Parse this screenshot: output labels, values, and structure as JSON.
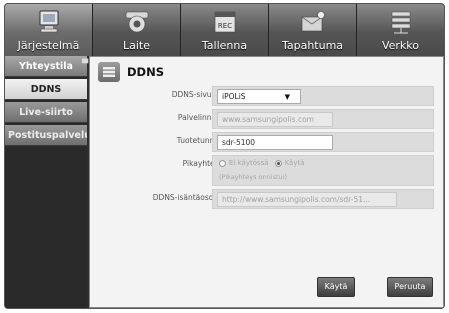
{
  "tabs": [
    {
      "label": "Järjestelmä",
      "icon": "system-icon"
    },
    {
      "label": "Laite",
      "icon": "camera-icon"
    },
    {
      "label": "Tallenna",
      "icon": "record-icon"
    },
    {
      "label": "Tapahtuma",
      "icon": "event-icon"
    },
    {
      "label": "Verkko",
      "icon": "network-icon"
    }
  ],
  "sidebar": {
    "items": [
      {
        "label": "Yhteystila"
      },
      {
        "label": "DDNS"
      },
      {
        "label": "Live-siirto"
      },
      {
        "label": "Postituspalvelu"
      }
    ]
  },
  "content": {
    "title": "DDNS",
    "service_label": "DDNS-sivusto",
    "service_value": "iPOLiS",
    "host_label": "Palvelinnimi",
    "host_value": "www.samsungipolis.com",
    "product_label": "Tuotetunnus",
    "product_value": "sdr-5100",
    "quick_label": "Pikayhteys",
    "quick_off": "Ei käytössä",
    "quick_on": "Käytä",
    "quick_note": "(Pikayhteys onnistui)",
    "address_label": "DDNS-isäntäosoite",
    "address_value": "http://www.samsungipolis.com/sdr-51..."
  },
  "buttons": {
    "apply": "Käytä",
    "cancel": "Peruuta"
  },
  "colors": {
    "background": "#2e2e2e",
    "panel": "#f3f3f3",
    "active_side": "#e6e6e6"
  }
}
